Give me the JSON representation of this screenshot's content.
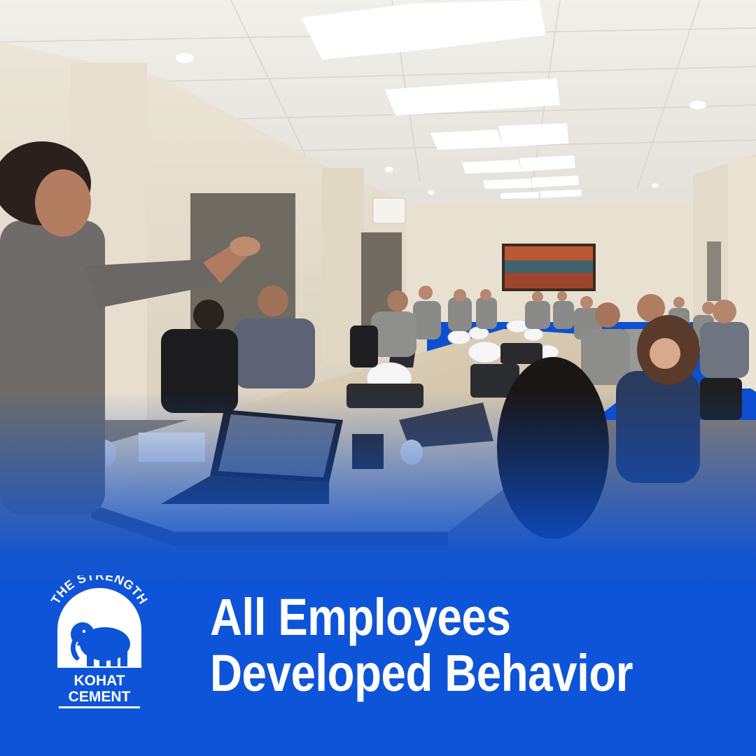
{
  "headline": {
    "line1": "All Employees",
    "line2": "Developed Behavior"
  },
  "logo": {
    "arc_text": "THE STRENGTH",
    "brand_line1": "KOHAT",
    "brand_line2": "CEMENT",
    "icon": "elephant-icon"
  },
  "colors": {
    "brand_blue": "#0d54d8",
    "text": "#ffffff"
  }
}
